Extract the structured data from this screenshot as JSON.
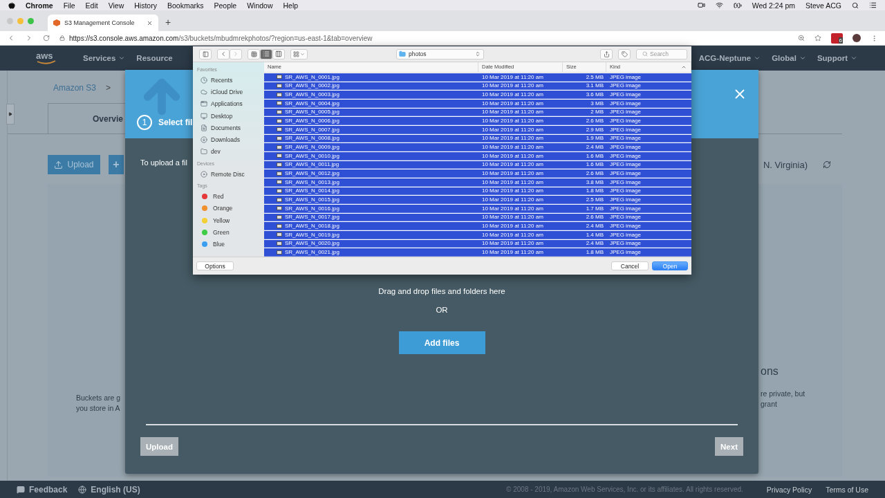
{
  "menu_bar": {
    "app": "Chrome",
    "items": [
      "File",
      "Edit",
      "View",
      "History",
      "Bookmarks",
      "People",
      "Window",
      "Help"
    ],
    "clock": "Wed 2:24 pm",
    "user": "Steve ACG"
  },
  "browser": {
    "tab_title": "S3 Management Console",
    "new_tab": "+",
    "url_host": "https://s3.console.aws.amazon.com",
    "url_path": "/s3/buckets/mbudmrekphotos/?region=us-east-1&tab=overview",
    "extension_badge": "6"
  },
  "aws_nav": {
    "logo": "aws",
    "left": [
      "Services",
      "Resource"
    ],
    "right": [
      "ACG-Neptune",
      "Global",
      "Support"
    ]
  },
  "page": {
    "breadcrumb": [
      "Amazon S3",
      ">"
    ],
    "tab": "Overvie",
    "upload_button": "Upload",
    "add_button": "+",
    "region": "N. Virginia)",
    "left_text": [
      "Buckets are g",
      "you store in A"
    ],
    "right_heading": "ons",
    "right_text": [
      "re private, but",
      "grant"
    ]
  },
  "upload_modal": {
    "step": "1",
    "step_title": "Select fil",
    "intro": "To upload a fil",
    "drop_hint": "Drag and drop files and folders here",
    "or": "OR",
    "add_files": "Add files",
    "upload": "Upload",
    "next": "Next"
  },
  "file_dialog": {
    "view_buttons": [
      {
        "kind": "icons",
        "selected": false
      },
      {
        "kind": "list",
        "selected": true
      },
      {
        "kind": "columns",
        "selected": false
      }
    ],
    "location": "photos",
    "search": {
      "placeholder": "Search"
    },
    "sidebar": [
      {
        "heading": "Favorites",
        "items": [
          {
            "kind": "recents",
            "label": "Recents"
          },
          {
            "kind": "cloud",
            "label": "iCloud Drive"
          },
          {
            "kind": "apps",
            "label": "Applications"
          },
          {
            "kind": "desktop",
            "label": "Desktop"
          },
          {
            "kind": "documents",
            "label": "Documents"
          },
          {
            "kind": "downloads",
            "label": "Downloads"
          },
          {
            "kind": "folder",
            "label": "dev"
          }
        ]
      },
      {
        "heading": "Devices",
        "items": [
          {
            "kind": "disc",
            "label": "Remote Disc"
          }
        ]
      },
      {
        "heading": "Tags",
        "items": [
          {
            "kind": "tag",
            "label": "Red",
            "color": "#e5383b"
          },
          {
            "kind": "tag",
            "label": "Orange",
            "color": "#f0912e"
          },
          {
            "kind": "tag",
            "label": "Yellow",
            "color": "#f5cf36"
          },
          {
            "kind": "tag",
            "label": "Green",
            "color": "#3fcb45"
          },
          {
            "kind": "tag",
            "label": "Blue",
            "color": "#3a9ff0"
          }
        ]
      }
    ],
    "columns": [
      "Name",
      "Date Modified",
      "Size",
      "Kind"
    ],
    "rows": [
      {
        "name": "SR_AWS_N_0001.jpg",
        "modified": "10 Mar 2019 at 11:20 am",
        "size": "2.5 MB",
        "kind": "JPEG image",
        "selected": true
      },
      {
        "name": "SR_AWS_N_0002.jpg",
        "modified": "10 Mar 2019 at 11:20 am",
        "size": "3.1 MB",
        "kind": "JPEG image",
        "selected": true
      },
      {
        "name": "SR_AWS_N_0003.jpg",
        "modified": "10 Mar 2019 at 11:20 am",
        "size": "3.6 MB",
        "kind": "JPEG image",
        "selected": true
      },
      {
        "name": "SR_AWS_N_0004.jpg",
        "modified": "10 Mar 2019 at 11:20 am",
        "size": "3 MB",
        "kind": "JPEG image",
        "selected": true
      },
      {
        "name": "SR_AWS_N_0005.jpg",
        "modified": "10 Mar 2019 at 11:20 am",
        "size": "2 MB",
        "kind": "JPEG image",
        "selected": true
      },
      {
        "name": "SR_AWS_N_0006.jpg",
        "modified": "10 Mar 2019 at 11:20 am",
        "size": "2.6 MB",
        "kind": "JPEG image",
        "selected": true
      },
      {
        "name": "SR_AWS_N_0007.jpg",
        "modified": "10 Mar 2019 at 11:20 am",
        "size": "2.9 MB",
        "kind": "JPEG image",
        "selected": true
      },
      {
        "name": "SR_AWS_N_0008.jpg",
        "modified": "10 Mar 2019 at 11:20 am",
        "size": "1.9 MB",
        "kind": "JPEG image",
        "selected": true
      },
      {
        "name": "SR_AWS_N_0009.jpg",
        "modified": "10 Mar 2019 at 11:20 am",
        "size": "2.4 MB",
        "kind": "JPEG image",
        "selected": true
      },
      {
        "name": "SR_AWS_N_0010.jpg",
        "modified": "10 Mar 2019 at 11:20 am",
        "size": "1.6 MB",
        "kind": "JPEG image",
        "selected": true
      },
      {
        "name": "SR_AWS_N_0011.jpg",
        "modified": "10 Mar 2019 at 11:20 am",
        "size": "1.6 MB",
        "kind": "JPEG image",
        "selected": true
      },
      {
        "name": "SR_AWS_N_0012.jpg",
        "modified": "10 Mar 2019 at 11:20 am",
        "size": "2.6 MB",
        "kind": "JPEG image",
        "selected": true
      },
      {
        "name": "SR_AWS_N_0013.jpg",
        "modified": "10 Mar 2019 at 11:20 am",
        "size": "3.8 MB",
        "kind": "JPEG image",
        "selected": true
      },
      {
        "name": "SR_AWS_N_0014.jpg",
        "modified": "10 Mar 2019 at 11:20 am",
        "size": "1.8 MB",
        "kind": "JPEG image",
        "selected": true
      },
      {
        "name": "SR_AWS_N_0015.jpg",
        "modified": "10 Mar 2019 at 11:20 am",
        "size": "2.5 MB",
        "kind": "JPEG image",
        "selected": true
      },
      {
        "name": "SR_AWS_N_0016.jpg",
        "modified": "10 Mar 2019 at 11:20 am",
        "size": "1.7 MB",
        "kind": "JPEG image",
        "selected": true
      },
      {
        "name": "SR_AWS_N_0017.jpg",
        "modified": "10 Mar 2019 at 11:20 am",
        "size": "2.6 MB",
        "kind": "JPEG image",
        "selected": true
      },
      {
        "name": "SR_AWS_N_0018.jpg",
        "modified": "10 Mar 2019 at 11:20 am",
        "size": "2.4 MB",
        "kind": "JPEG image",
        "selected": true
      },
      {
        "name": "SR_AWS_N_0019.jpg",
        "modified": "10 Mar 2019 at 11:20 am",
        "size": "1.4 MB",
        "kind": "JPEG image",
        "selected": true
      },
      {
        "name": "SR_AWS_N_0020.jpg",
        "modified": "10 Mar 2019 at 11:20 am",
        "size": "2.4 MB",
        "kind": "JPEG image",
        "selected": true
      },
      {
        "name": "SR_AWS_N_0021.jpg",
        "modified": "10 Mar 2019 at 11:20 am",
        "size": "1.8 MB",
        "kind": "JPEG image",
        "selected": true
      }
    ],
    "buttons": {
      "options": "Options",
      "cancel": "Cancel",
      "open": "Open"
    }
  },
  "footer": {
    "feedback": "Feedback",
    "language": "English (US)",
    "copyright": "© 2008 - 2019, Amazon Web Services, Inc. or its affiliates. All rights reserved.",
    "links": [
      "Privacy Policy",
      "Terms of Use"
    ]
  }
}
